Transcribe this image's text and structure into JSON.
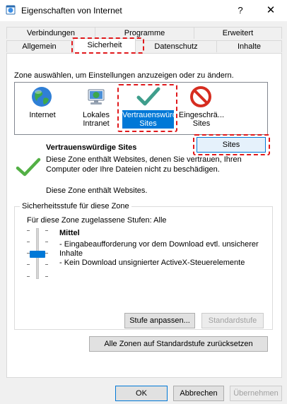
{
  "window": {
    "title": "Eigenschaften von Internet",
    "help_glyph": "?",
    "close_glyph": "✕"
  },
  "tabs": {
    "row1": [
      "Verbindungen",
      "Programme",
      "Erweitert"
    ],
    "row2": [
      "Allgemein",
      "Sicherheit",
      "Datenschutz",
      "Inhalte"
    ],
    "active": "Sicherheit"
  },
  "security": {
    "instruction": "Zone auswählen, um Einstellungen anzuzeigen oder zu ändern.",
    "zones": [
      {
        "label": "Internet",
        "icon": "globe-icon"
      },
      {
        "label": "Lokales Intranet",
        "icon": "intranet-icon"
      },
      {
        "label": "Vertrauenswürdige Sites",
        "icon": "checkmark-icon",
        "selected": true
      },
      {
        "label": "Eingeschrä... Sites",
        "icon": "restricted-icon"
      }
    ],
    "zone_title": "Vertrauenswürdige Sites",
    "zone_desc": "Diese Zone enthält Websites, denen Sie vertrauen, Ihren Computer oder Ihre Dateien nicht zu beschädigen.",
    "zone_note": "Diese Zone enthält Websites.",
    "sites_button": "Sites",
    "level_group_title": "Sicherheitsstufe für diese Zone",
    "allowed_levels": "Für diese Zone zugelassene Stufen: Alle",
    "level_name": "Mittel",
    "level_bullets": [
      "- Eingabeaufforderung vor dem Download evtl. unsicherer Inhalte",
      "- Kein Download unsignierter ActiveX-Steuerelemente"
    ],
    "custom_level_button": "Stufe anpassen...",
    "default_level_button": "Standardstufe",
    "reset_all_button": "Alle Zonen auf Standardstufe zurücksetzen"
  },
  "footer": {
    "ok": "OK",
    "cancel": "Abbrechen",
    "apply": "Übernehmen"
  },
  "colors": {
    "accent": "#0078d7",
    "highlight_dash": "#e0191c",
    "trusted_green": "#3f9e8c"
  }
}
